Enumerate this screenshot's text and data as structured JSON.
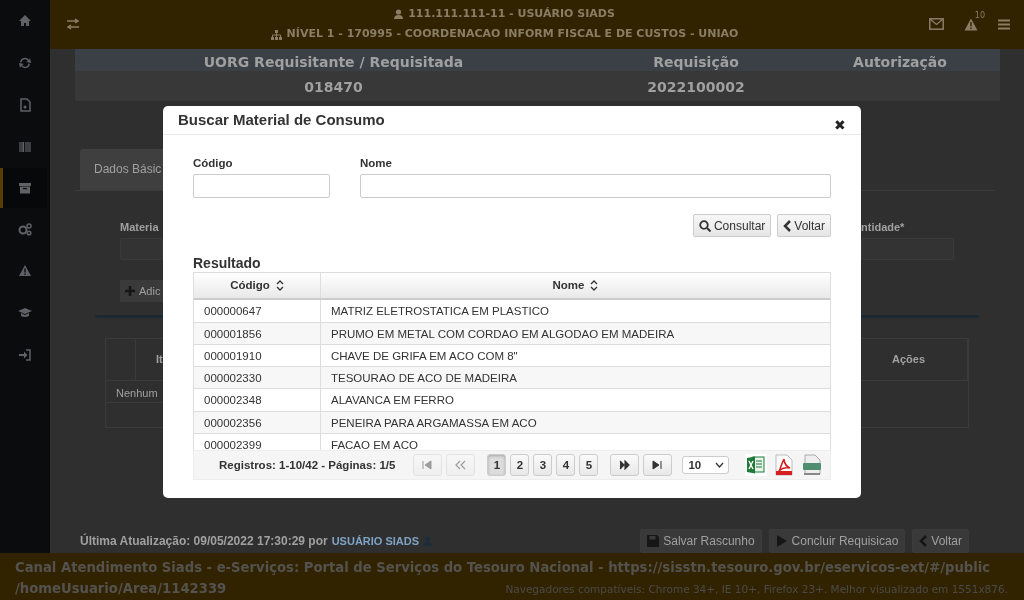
{
  "header": {
    "user": "111.111.111-11 - USUÁRIO SIADS",
    "unit": "NÍVEL 1 - 170995 - COORDENACAO INFORM FISCAL E DE CUSTOS - UNIAO",
    "alert_count": "10"
  },
  "sidebar": {
    "items": [
      {
        "kind": "home",
        "selected": false
      },
      {
        "kind": "refresh",
        "selected": false
      },
      {
        "kind": "file",
        "selected": false
      },
      {
        "kind": "barcode",
        "selected": false
      },
      {
        "kind": "archive",
        "selected": true
      },
      {
        "kind": "cogs",
        "selected": false
      },
      {
        "kind": "warning",
        "selected": false
      },
      {
        "kind": "cap",
        "selected": false
      },
      {
        "kind": "signin",
        "selected": false
      }
    ]
  },
  "summary": {
    "columns": [
      "UORG Requisitante / Requisitada",
      "Requisição",
      "Autorização"
    ],
    "values": [
      "018470",
      "2022100002"
    ]
  },
  "tabs": [
    {
      "label": "Dados Básic",
      "selected": true
    }
  ],
  "form": {
    "material_label": "Materia",
    "quantity_label": "ntidade*",
    "add_button": "Adic"
  },
  "items_table": {
    "columns": [
      "It",
      "Ações"
    ],
    "empty_text": "Nenhum"
  },
  "last_update": {
    "text": "Última Atualização: 09/05/2022 17:30:29 por",
    "user": "USUÁRIO SIADS"
  },
  "actions": [
    {
      "label": "Salvar Rascunho",
      "kind": "save"
    },
    {
      "label": "Concluir Requisicao",
      "kind": "play"
    },
    {
      "label": "Voltar",
      "kind": "back"
    }
  ],
  "footer": {
    "lines": [
      "Canal Atendimento Siads - e-Serviços: Portal de Serviços do Tesouro Nacional - https://sisstn.tesouro.gov.br/eservicos-ext/#/public",
      "/homeUsuario/Area/1142339"
    ],
    "compat": "Navegadores compatíveis: Chrome 34+, IE 10+, Firefox 23+. Melhor visualizado em 1551x876."
  },
  "modal": {
    "title": "Buscar Material de Consumo",
    "close": "✖",
    "fields": [
      {
        "label": "Código"
      },
      {
        "label": "Nome"
      }
    ],
    "buttons": [
      {
        "label": "Consultar",
        "kind": "search"
      },
      {
        "label": "Voltar",
        "kind": "back"
      }
    ],
    "result_title": "Resultado",
    "table": {
      "columns": [
        {
          "label": "Código",
          "sortable": true
        },
        {
          "label": "Nome",
          "sortable": true
        }
      ],
      "rows": [
        [
          "000000647",
          "MATRIZ ELETROSTATICA EM PLASTICO"
        ],
        [
          "000001856",
          "PRUMO EM METAL COM CORDAO EM ALGODAO EM MADEIRA"
        ],
        [
          "000001910",
          "CHAVE DE GRIFA EM ACO COM 8\""
        ],
        [
          "000002330",
          "TESOURAO DE ACO DE MADEIRA"
        ],
        [
          "000002348",
          "ALAVANCA EM FERRO"
        ],
        [
          "000002356",
          "PENEIRA PARA ARGAMASSA EM ACO"
        ],
        [
          "000002399",
          "FACAO EM ACO"
        ]
      ]
    },
    "pager": {
      "summary": "Registros: 1-10/42 - Páginas: 1/5",
      "nav": [
        {
          "kind": "first",
          "disabled": true
        },
        {
          "kind": "prev",
          "disabled": true
        }
      ],
      "pages": [
        {
          "label": "1",
          "selected": true
        },
        {
          "label": "2",
          "selected": false
        },
        {
          "label": "3",
          "selected": false
        },
        {
          "label": "4",
          "selected": false
        },
        {
          "label": "5",
          "selected": false
        }
      ],
      "nav_after": [
        {
          "kind": "next",
          "disabled": false
        },
        {
          "kind": "last",
          "disabled": false
        }
      ],
      "page_size": "10",
      "exports": [
        {
          "kind": "excel"
        },
        {
          "kind": "pdf"
        },
        {
          "kind": "csv"
        }
      ]
    }
  }
}
